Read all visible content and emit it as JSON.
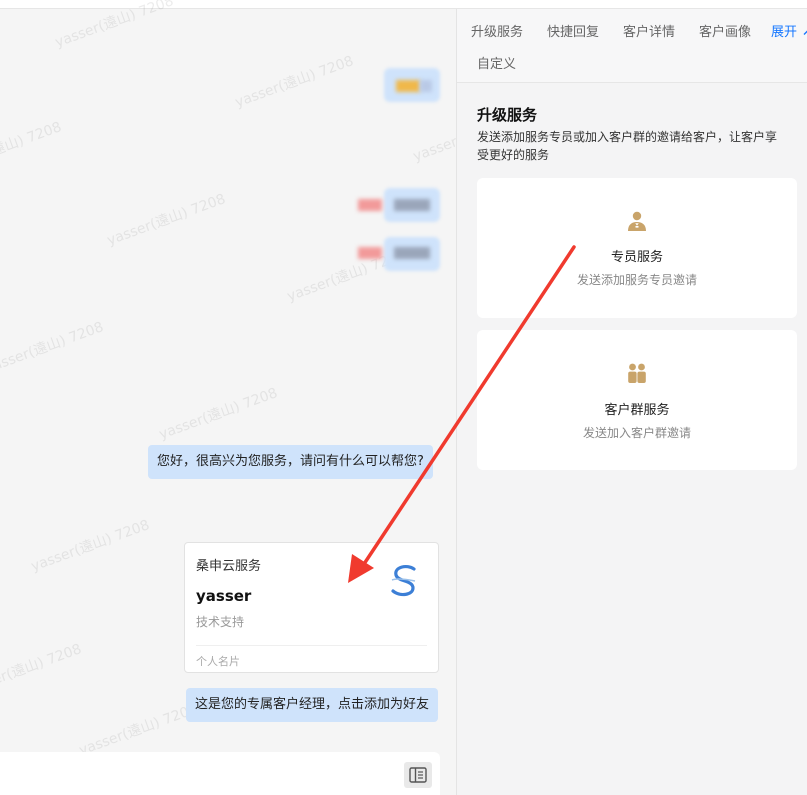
{
  "tabs": {
    "upgrade": "升级服务",
    "quick_reply": "快捷回复",
    "customer_detail": "客户详情",
    "customer_profile": "客户画像",
    "expand": "展开",
    "custom": "自定义"
  },
  "panel": {
    "title": "升级服务",
    "description": "发送添加服务专员或加入客户群的邀请给客户，让客户享受更好的服务",
    "cards": [
      {
        "title": "专员服务",
        "desc": "发送添加服务专员邀请",
        "icon": "agent-icon"
      },
      {
        "title": "客户群服务",
        "desc": "发送加入客户群邀请",
        "icon": "group-icon"
      }
    ]
  },
  "chat": {
    "watermark": "yasser(遠山) 7208",
    "messages": [
      "您好，很高兴为您服务，请问有什么可以帮您?",
      "这是您的专属客户经理，点击添加为好友"
    ],
    "card": {
      "company": "桑申云服务",
      "name": "yasser",
      "role": "技术支持",
      "type": "个人名片"
    },
    "input_icon": "sidebar-toggle-icon"
  },
  "colors": {
    "accent": "#1677ff",
    "bubble": "#cfe3fb",
    "arrow": "#f03a2e",
    "icon_gold": "#c9a46a"
  }
}
